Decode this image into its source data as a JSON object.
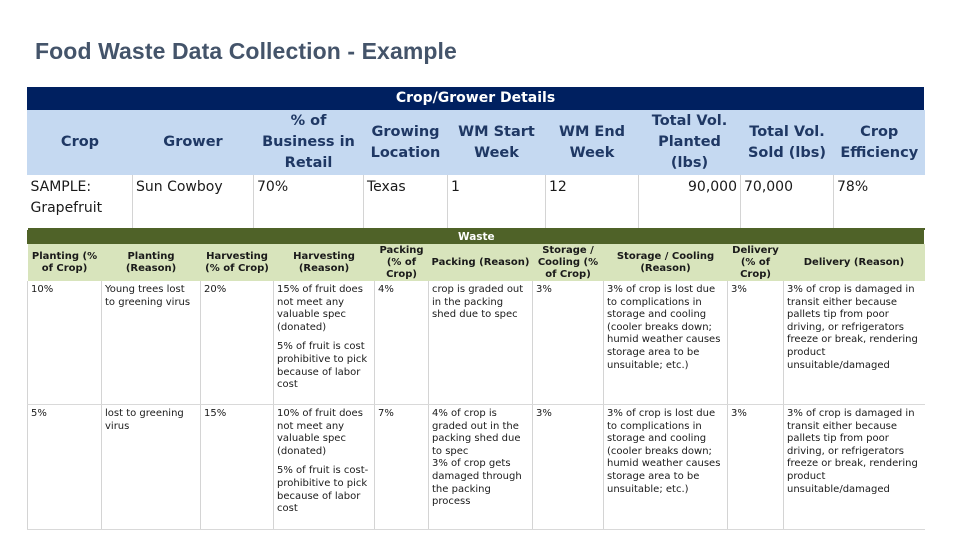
{
  "page": {
    "title": "Food Waste Data Collection - Example"
  },
  "crop_grower": {
    "section_title": "Crop/Grower Details",
    "headers": [
      "Crop",
      "Grower",
      "% of Business in Retail",
      "Growing Location",
      "WM Start Week",
      "WM End Week",
      "Total Vol. Planted (lbs)",
      "Total Vol. Sold (lbs)",
      "Crop Efficiency"
    ],
    "row": {
      "crop": "SAMPLE: Grapefruit",
      "grower": "Sun Cowboy",
      "pct_retail": "70%",
      "location": "Texas",
      "wm_start_week": "1",
      "wm_end_week": "12",
      "total_planted": "90,000",
      "total_sold": "70,000",
      "crop_efficiency": "78%"
    }
  },
  "waste": {
    "section_title": "Waste",
    "headers": [
      "Planting (% of Crop)",
      "Planting (Reason)",
      "Harvesting (% of Crop)",
      "Harvesting (Reason)",
      "Packing (% of Crop)",
      "Packing (Reason)",
      "Storage / Cooling (% of Crop)",
      "Storage / Cooling (Reason)",
      "Delivery (% of Crop)",
      "Delivery (Reason)"
    ],
    "rows": [
      {
        "planting_pct": "10%",
        "planting_reason": "Young trees lost to greening virus",
        "harvesting_pct": "20%",
        "harvesting_reason_1": "15% of fruit does not meet any valuable spec (donated)",
        "harvesting_reason_2": "5% of fruit is cost prohibitive to pick because of labor cost",
        "packing_pct": "4%",
        "packing_reason_1": "crop is graded out in the packing shed due to spec",
        "packing_reason_2": "",
        "storage_pct": "3%",
        "storage_reason": "3% of crop is lost due to complications in storage and cooling (cooler breaks down; humid weather causes storage area to be unsuitable; etc.)",
        "delivery_pct": "3%",
        "delivery_reason": "3% of crop is damaged in transit either because pallets tip from poor driving, or refrigerators freeze or break, rendering product unsuitable/damaged"
      },
      {
        "planting_pct": "5%",
        "planting_reason": "lost to greening virus",
        "harvesting_pct": "15%",
        "harvesting_reason_1": "10% of fruit does not meet any valuable spec (donated)",
        "harvesting_reason_2": "5% of fruit is cost-prohibitive to pick because of labor cost",
        "packing_pct": "7%",
        "packing_reason_1": "4% of crop is graded out in the packing shed due to spec",
        "packing_reason_2": "3% of crop gets damaged through the packing process",
        "storage_pct": "3%",
        "storage_reason": "3% of crop is lost due to complications in storage and cooling (cooler breaks down; humid weather causes storage area to be unsuitable; etc.)",
        "delivery_pct": "3%",
        "delivery_reason": "3% of crop is damaged in transit either because pallets tip from poor driving, or refrigerators freeze or break, rendering product unsuitable/damaged"
      }
    ]
  },
  "colors": {
    "title": "#44546a",
    "crop_section_bar": "#002060",
    "crop_header_bg": "#c5d9f1",
    "waste_section_bar": "#4f6228",
    "waste_header_bg": "#d8e4bc"
  }
}
